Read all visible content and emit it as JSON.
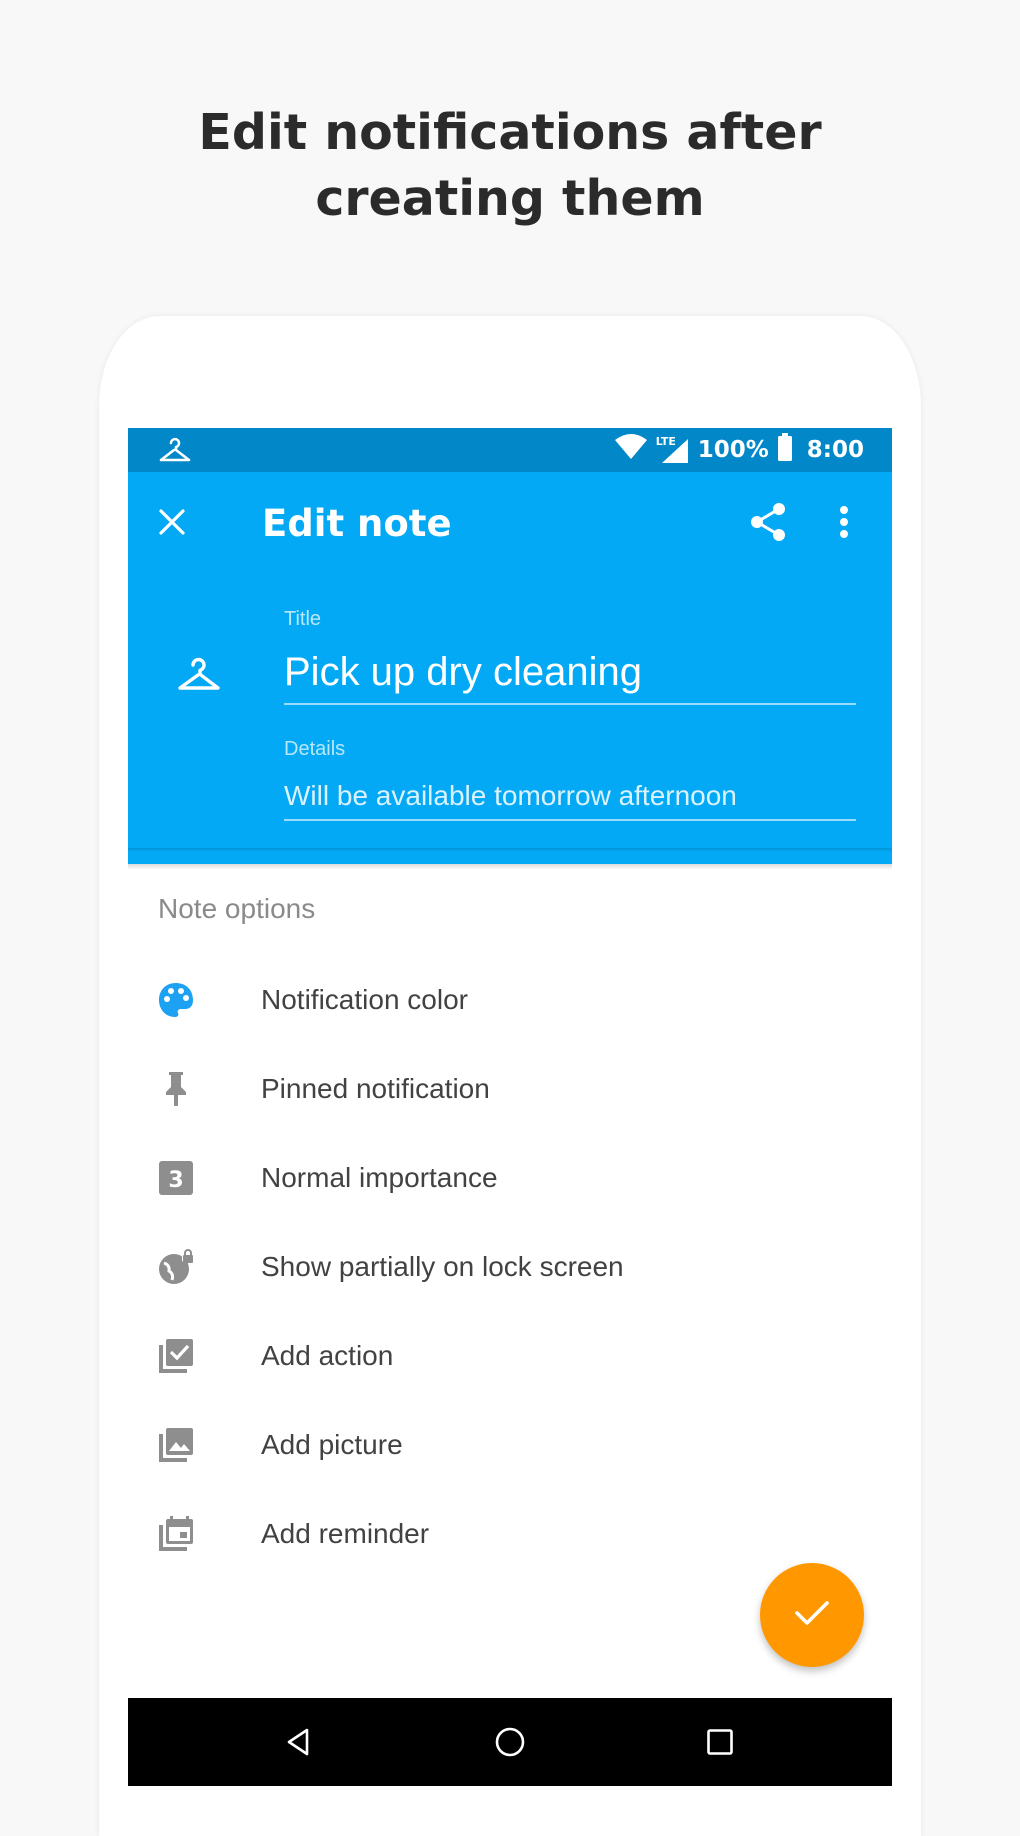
{
  "headline": {
    "line1": "Edit notifications after",
    "line2": "creating them"
  },
  "status_bar": {
    "left_icon": "hanger-icon",
    "network": "LTE",
    "battery": "100%",
    "time": "8:00"
  },
  "app_bar": {
    "title": "Edit note",
    "close_icon": "close-icon",
    "share_icon": "share-icon",
    "more_icon": "more-vert-icon"
  },
  "note": {
    "icon": "hanger-icon",
    "title_label": "Title",
    "title_value": "Pick up dry cleaning",
    "details_label": "Details",
    "details_value": "Will be available tomorrow afternoon"
  },
  "options": {
    "section_label": "Note options",
    "items": [
      {
        "label": "Notification color",
        "icon": "palette-icon"
      },
      {
        "label": "Pinned notification",
        "icon": "pin-icon"
      },
      {
        "label": "Normal importance",
        "icon": "importance-3-icon"
      },
      {
        "label": "Show partially on lock screen",
        "icon": "lock-screen-icon"
      },
      {
        "label": "Add action",
        "icon": "action-icon"
      },
      {
        "label": "Add picture",
        "icon": "picture-icon"
      },
      {
        "label": "Add reminder",
        "icon": "reminder-icon"
      }
    ]
  },
  "fab": {
    "icon": "check-icon"
  },
  "nav_bar": {
    "back_icon": "back-icon",
    "home_icon": "home-icon",
    "recents_icon": "recents-icon"
  },
  "colors": {
    "status_bar": "#0287c8",
    "app_bar": "#03a9f4",
    "fab": "#ff9800",
    "palette_icon": "#1da1f2",
    "option_icon": "#8e8e8e"
  }
}
